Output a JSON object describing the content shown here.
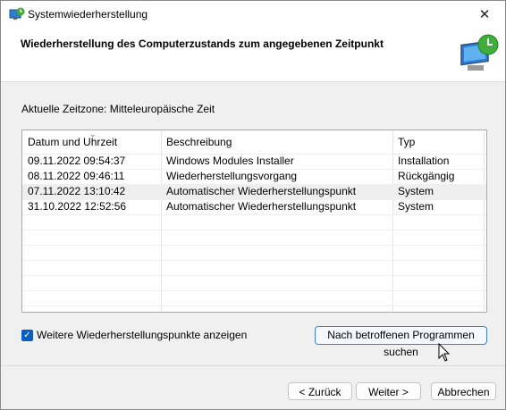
{
  "window": {
    "title": "Systemwiederherstellung",
    "close_glyph": "✕"
  },
  "header": {
    "title": "Wiederherstellung des Computerzustands zum angegebenen Zeitpunkt",
    "icon": "system-restore-icon"
  },
  "timezone_label": "Aktuelle Zeitzone: Mitteleuropäische Zeit",
  "table": {
    "columns": [
      "Datum und Uhrzeit",
      "Beschreibung",
      "Typ"
    ],
    "sort_indicator": "⌄",
    "rows": [
      [
        "09.11.2022 09:54:37",
        "Windows Modules Installer",
        "Installation"
      ],
      [
        "08.11.2022 09:46:11",
        "Wiederherstellungsvorgang",
        "Rückgängig"
      ],
      [
        "07.11.2022 13:10:42",
        "Automatischer Wiederherstellungspunkt",
        "System"
      ],
      [
        "31.10.2022 12:52:56",
        "Automatischer Wiederherstellungspunkt",
        "System"
      ]
    ]
  },
  "show_more": {
    "label": "Weitere Wiederherstellungspunkte anzeigen",
    "checked": true,
    "check_glyph": "✓"
  },
  "buttons": {
    "search": "Nach betroffenen Programmen suchen",
    "back": "< Zurück",
    "next": "Weiter >",
    "cancel": "Abbrechen"
  },
  "colors": {
    "accent": "#0a5ec2",
    "focus_border": "#3b7fd8"
  }
}
